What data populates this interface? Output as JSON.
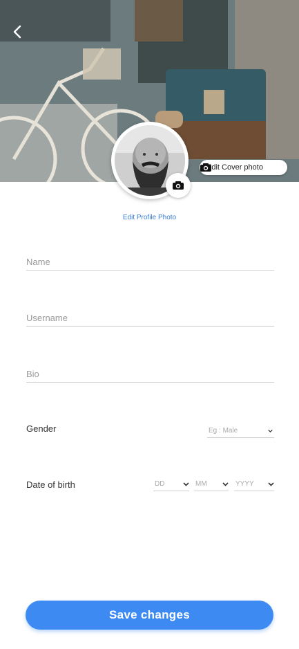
{
  "header": {
    "back_icon": "chevron-left-icon",
    "edit_cover_label": "Edit Cover photo",
    "cover_camera_icon": "camera-icon"
  },
  "profile": {
    "avatar_camera_icon": "camera-icon",
    "edit_photo_label": "Edit Profile Photo"
  },
  "form": {
    "name_placeholder": "Name",
    "username_placeholder": "Username",
    "bio_placeholder": "Bio",
    "gender_label": "Gender",
    "gender_placeholder": "Eg : Male",
    "dob_label": "Date of birth",
    "dob_day_placeholder": "DD",
    "dob_month_placeholder": "MM",
    "dob_year_placeholder": "YYYY",
    "chevron_icon": "chevron-down-icon"
  },
  "actions": {
    "save_label": "Save changes"
  },
  "colors": {
    "accent": "#3d8bf2",
    "link": "#3a7bd5"
  }
}
